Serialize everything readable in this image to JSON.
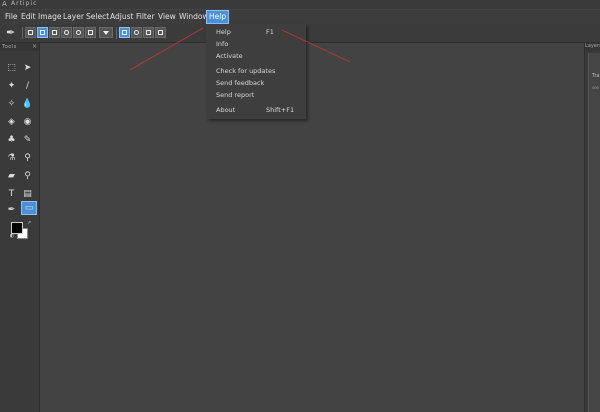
{
  "app": {
    "title": "Artipic",
    "logo_glyph": "A"
  },
  "menubar": {
    "items": [
      {
        "label": "File"
      },
      {
        "label": "Edit"
      },
      {
        "label": "Image"
      },
      {
        "label": "Layer"
      },
      {
        "label": "Select"
      },
      {
        "label": "Adjust"
      },
      {
        "label": "Filter"
      },
      {
        "label": "View"
      },
      {
        "label": "Window"
      },
      {
        "label": "Help"
      }
    ],
    "active": "Help"
  },
  "help_menu": {
    "items": [
      {
        "label": "Help",
        "shortcut": "F1"
      },
      {
        "label": "Info",
        "shortcut": ""
      },
      {
        "label": "Activate",
        "shortcut": ""
      },
      {
        "label": "Check for updates",
        "shortcut": ""
      },
      {
        "label": "Send feedback",
        "shortcut": ""
      },
      {
        "label": "Send report",
        "shortcut": ""
      },
      {
        "label": "About",
        "shortcut": "Shift+F1"
      }
    ]
  },
  "toolbox": {
    "title": "Tools",
    "close_glyph": "×"
  },
  "right_panel": {
    "title": "Layers",
    "line1": "Tra",
    "line2": "see"
  },
  "colors": {
    "accent": "#4a90d9",
    "annotation_arrow": "#c0392b",
    "foreground": "#000000",
    "background": "#ffffff"
  },
  "tools": [
    {
      "icon": "marquee-select-icon",
      "glyph": "⬚"
    },
    {
      "icon": "move-arrow-icon",
      "glyph": "➤"
    },
    {
      "icon": "magic-wand-icon",
      "glyph": "✦"
    },
    {
      "icon": "brush-icon",
      "glyph": "/"
    },
    {
      "icon": "sparkle-icon",
      "glyph": "✧"
    },
    {
      "icon": "drop-icon",
      "glyph": "💧"
    },
    {
      "icon": "eraser-icon",
      "glyph": "◈"
    },
    {
      "icon": "blur-icon",
      "glyph": "◉"
    },
    {
      "icon": "stamp-icon",
      "glyph": "♣"
    },
    {
      "icon": "pencil-icon",
      "glyph": "✎"
    },
    {
      "icon": "eyedropper-icon",
      "glyph": "⚗"
    },
    {
      "icon": "picker-icon",
      "glyph": "⚲"
    },
    {
      "icon": "fill-icon",
      "glyph": "▰"
    },
    {
      "icon": "zoom-icon",
      "glyph": "⚲"
    },
    {
      "icon": "text-icon",
      "glyph": "T"
    },
    {
      "icon": "gradient-icon",
      "glyph": "▤"
    },
    {
      "icon": "pen-icon",
      "glyph": "✒"
    },
    {
      "icon": "rectangle-icon",
      "glyph": "▭"
    }
  ]
}
